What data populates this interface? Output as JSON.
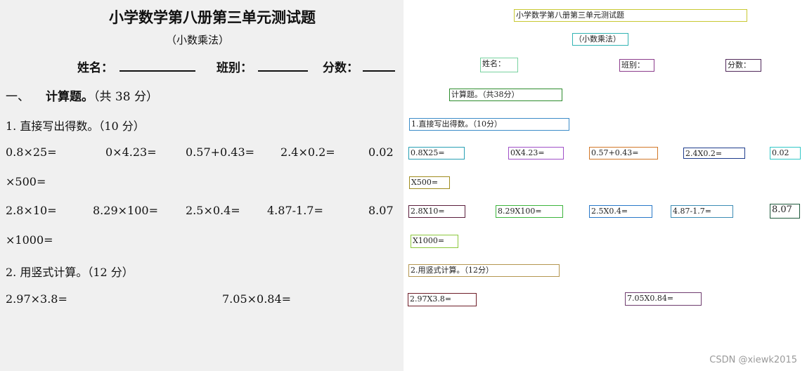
{
  "document": {
    "title": "小学数学第八册第三单元测试题",
    "subtitle": "（小数乘法）",
    "fields": {
      "name": "姓名：",
      "class": "班别：",
      "score": "分数："
    },
    "section1": {
      "number": "一、",
      "heading": "计算题。",
      "points": "（共 38 分）"
    },
    "part1": "1. 直接写出得数。（10 分）",
    "row1": [
      "0.8×25=",
      "0×4.23=",
      "0.57+0.43=",
      "2.4×0.2=",
      "0.02"
    ],
    "row1_cont": "×500=",
    "row2": [
      "2.8×10=",
      "8.29×100=",
      "2.5×0.4=",
      "4.87-1.7=",
      "8.07"
    ],
    "row2_cont": "×1000=",
    "part2": "2. 用竖式计算。（12 分）",
    "row3": [
      "2.97×3.8=",
      "7.05×0.84="
    ]
  },
  "ocr_boxes": [
    {
      "text": "小学数学第八册第三单元测试题",
      "color": "#c8c832"
    },
    {
      "text": "（小数乘法）",
      "color": "#32b4b4"
    },
    {
      "text": "姓名：",
      "color": "#78d2a0"
    },
    {
      "text": "班别：",
      "color": "#8c3c8c"
    },
    {
      "text": "分数：",
      "color": "#50285a"
    },
    {
      "text": "计算题。（共38分）",
      "color": "#2d8c2d"
    },
    {
      "text": "1.直接写出得数。（10分）",
      "color": "#3c8cc8"
    },
    {
      "text": "0.8X25=",
      "color": "#28a0b4"
    },
    {
      "text": "0X4.23=",
      "color": "#a050c8"
    },
    {
      "text": "0.57+0.43=",
      "color": "#d27828"
    },
    {
      "text": "2.4X0.2=",
      "color": "#1e3c8c"
    },
    {
      "text": "0.02",
      "color": "#32c8c8"
    },
    {
      "text": "X500=",
      "color": "#a08c1e"
    },
    {
      "text": "2.8X10=",
      "color": "#5a1e3c"
    },
    {
      "text": "8.29X100=",
      "color": "#3cb43c"
    },
    {
      "text": "2.5X0.4=",
      "color": "#2878c8"
    },
    {
      "text": "4.87-1.7=",
      "color": "#3c8cb4"
    },
    {
      "text": "8.07",
      "color": "#1e5a3c"
    },
    {
      "text": "X1000=",
      "color": "#8cc83c"
    },
    {
      "text": "2.用竖式计算。（12分）",
      "color": "#b49650"
    },
    {
      "text": "2.97X3.8=",
      "color": "#6e1e28"
    },
    {
      "text": "7.05X0.84=",
      "color": "#6e3c6e"
    }
  ],
  "watermark": "CSDN @xiewk2015"
}
